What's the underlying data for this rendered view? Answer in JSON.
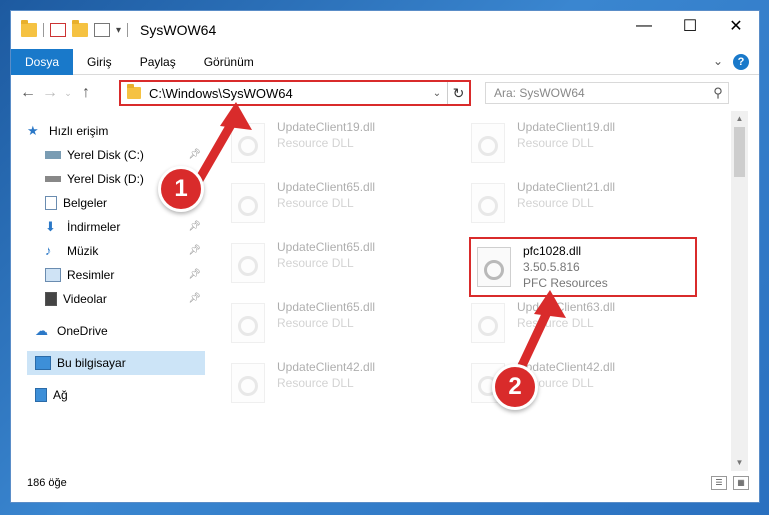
{
  "window": {
    "title": "SysWOW64",
    "controls": [
      "minimize-icon",
      "maximize-icon",
      "close-icon"
    ]
  },
  "ribbon": {
    "tabs": [
      "Dosya",
      "Giriş",
      "Paylaş",
      "Görünüm"
    ],
    "active": "Dosya",
    "help": "?"
  },
  "navigation": {
    "address": "C:\\Windows\\SysWOW64",
    "search_placeholder": "Ara: SysWOW64"
  },
  "sidebar": {
    "items": [
      {
        "label": "Hızlı erişim",
        "icon": "star-icon"
      },
      {
        "label": "Yerel Disk (C:)",
        "icon": "drive-icon"
      },
      {
        "label": "Yerel Disk (D:)",
        "icon": "drive-icon"
      },
      {
        "label": "Belgeler",
        "icon": "document-icon"
      },
      {
        "label": "İndirmeler",
        "icon": "download-icon"
      },
      {
        "label": "Müzik",
        "icon": "music-icon"
      },
      {
        "label": "Resimler",
        "icon": "image-icon"
      },
      {
        "label": "Videolar",
        "icon": "video-icon"
      },
      {
        "label": "OneDrive",
        "icon": "cloud-icon"
      },
      {
        "label": "Bu bilgisayar",
        "icon": "computer-icon"
      },
      {
        "label": "Ağ",
        "icon": "network-icon"
      }
    ]
  },
  "files": {
    "faded": [
      {
        "name": "UpdateClient19.dll",
        "desc": "Resource DLL"
      },
      {
        "name": "UpdateClient19.dll",
        "desc": "Resource DLL"
      },
      {
        "name": "UpdateClient65.dll",
        "desc": "Resource DLL"
      },
      {
        "name": "UpdateClient21.dll",
        "desc": "Resource DLL"
      },
      {
        "name": "UpdateClient65.dll",
        "desc": "Resource DLL"
      },
      {
        "name": "UpdateClient65.dll",
        "desc": "Resource DLL"
      },
      {
        "name": "UpdateClient63.dll",
        "desc": "Resource DLL"
      },
      {
        "name": "UpdateClient42.dll",
        "desc": "Resource DLL"
      },
      {
        "name": "UpdateClient42.dll",
        "desc": "Resource DLL"
      }
    ],
    "highlighted": {
      "name": "pfc1028.dll",
      "version": "3.50.5.816",
      "desc": "PFC Resources"
    }
  },
  "status": {
    "count": "186 öğe"
  },
  "annotations": {
    "step1": "1",
    "step2": "2",
    "color": "#d92b2b"
  }
}
